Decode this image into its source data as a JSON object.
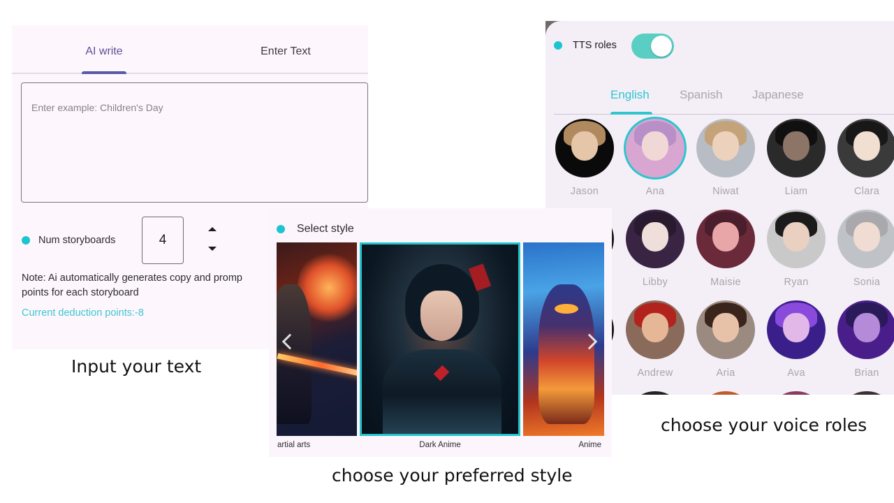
{
  "input_panel": {
    "tabs": [
      {
        "label": "AI write",
        "active": true
      },
      {
        "label": "Enter Text",
        "active": false
      }
    ],
    "prompt_placeholder": "Enter example: Children's Day",
    "prompt_value": "",
    "num_storyboards_label": "Num storyboards",
    "num_storyboards_value": "4",
    "note": "Note: Ai automatically generates copy and promp",
    "note_line2": "points for each storyboard",
    "deduction": "Current deduction points:-8",
    "caption": "Input your text"
  },
  "style_panel": {
    "title": "Select style",
    "styles": [
      {
        "label": "artial arts",
        "selected": false
      },
      {
        "label": "Dark Anime",
        "selected": true
      },
      {
        "label": "Anime",
        "selected": false
      }
    ],
    "caption": "choose your preferred style"
  },
  "voice_panel": {
    "tts_label": "TTS roles",
    "tts_enabled": true,
    "languages": [
      {
        "label": "English",
        "active": true
      },
      {
        "label": "Spanish",
        "active": false
      },
      {
        "label": "Japanese",
        "active": false
      }
    ],
    "voices": [
      {
        "name": "Jason",
        "selected": false
      },
      {
        "name": "Ana",
        "selected": true
      },
      {
        "name": "Niwat",
        "selected": false
      },
      {
        "name": "Liam",
        "selected": false
      },
      {
        "name": "Clara",
        "selected": false
      },
      {
        "name": "",
        "selected": false
      },
      {
        "name": "Libby",
        "selected": false
      },
      {
        "name": "Maisie",
        "selected": false
      },
      {
        "name": "Ryan",
        "selected": false
      },
      {
        "name": "Sonia",
        "selected": false
      },
      {
        "name": "",
        "selected": false
      },
      {
        "name": "Andrew",
        "selected": false
      },
      {
        "name": "Aria",
        "selected": false
      },
      {
        "name": "Ava",
        "selected": false
      },
      {
        "name": "Brian",
        "selected": false
      }
    ],
    "caption": "choose your voice roles"
  },
  "colors": {
    "accent": "#1cc4cf",
    "tab_active": "#5e4e93",
    "toggle_on": "#5bcec4"
  }
}
